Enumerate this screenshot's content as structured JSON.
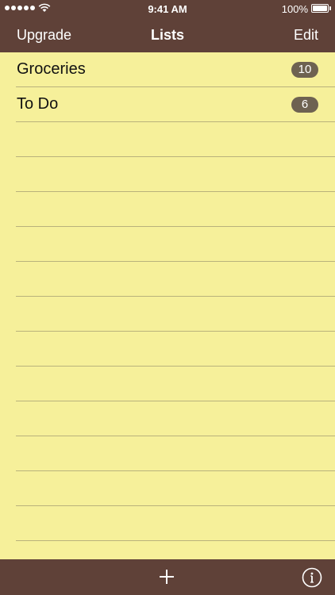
{
  "status_bar": {
    "time": "9:41 AM",
    "battery_percent": "100%",
    "signal_bars": 5,
    "battery_level": 1.0
  },
  "nav": {
    "left_button": "Upgrade",
    "title": "Lists",
    "right_button": "Edit"
  },
  "lists": [
    {
      "name": "Groceries",
      "count": "10"
    },
    {
      "name": "To Do",
      "count": "6"
    }
  ],
  "toolbar": {
    "add_icon": "plus-icon",
    "info_icon": "info-icon"
  },
  "colors": {
    "bar_brown": "#5f4138",
    "paper_yellow": "#f6f09a",
    "rule_line": "#b9b27c",
    "badge": "#6e6251"
  }
}
